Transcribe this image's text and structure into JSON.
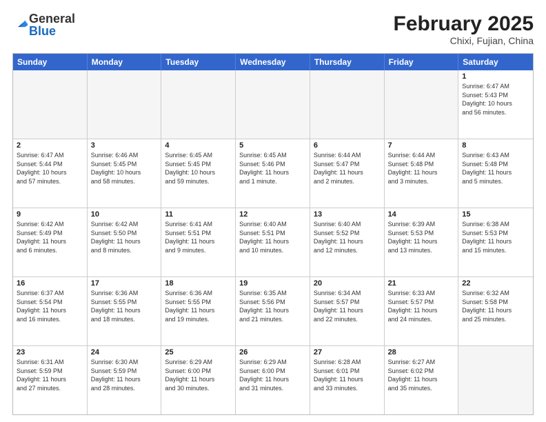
{
  "header": {
    "logo_general": "General",
    "logo_blue": "Blue",
    "month_title": "February 2025",
    "location": "Chixi, Fujian, China"
  },
  "calendar": {
    "days": [
      "Sunday",
      "Monday",
      "Tuesday",
      "Wednesday",
      "Thursday",
      "Friday",
      "Saturday"
    ],
    "rows": [
      [
        {
          "day": "",
          "empty": true
        },
        {
          "day": "",
          "empty": true
        },
        {
          "day": "",
          "empty": true
        },
        {
          "day": "",
          "empty": true
        },
        {
          "day": "",
          "empty": true
        },
        {
          "day": "",
          "empty": true
        },
        {
          "day": "1",
          "info": "Sunrise: 6:47 AM\nSunset: 5:43 PM\nDaylight: 10 hours\nand 56 minutes."
        }
      ],
      [
        {
          "day": "2",
          "info": "Sunrise: 6:47 AM\nSunset: 5:44 PM\nDaylight: 10 hours\nand 57 minutes."
        },
        {
          "day": "3",
          "info": "Sunrise: 6:46 AM\nSunset: 5:45 PM\nDaylight: 10 hours\nand 58 minutes."
        },
        {
          "day": "4",
          "info": "Sunrise: 6:45 AM\nSunset: 5:45 PM\nDaylight: 10 hours\nand 59 minutes."
        },
        {
          "day": "5",
          "info": "Sunrise: 6:45 AM\nSunset: 5:46 PM\nDaylight: 11 hours\nand 1 minute."
        },
        {
          "day": "6",
          "info": "Sunrise: 6:44 AM\nSunset: 5:47 PM\nDaylight: 11 hours\nand 2 minutes."
        },
        {
          "day": "7",
          "info": "Sunrise: 6:44 AM\nSunset: 5:48 PM\nDaylight: 11 hours\nand 3 minutes."
        },
        {
          "day": "8",
          "info": "Sunrise: 6:43 AM\nSunset: 5:48 PM\nDaylight: 11 hours\nand 5 minutes."
        }
      ],
      [
        {
          "day": "9",
          "info": "Sunrise: 6:42 AM\nSunset: 5:49 PM\nDaylight: 11 hours\nand 6 minutes."
        },
        {
          "day": "10",
          "info": "Sunrise: 6:42 AM\nSunset: 5:50 PM\nDaylight: 11 hours\nand 8 minutes."
        },
        {
          "day": "11",
          "info": "Sunrise: 6:41 AM\nSunset: 5:51 PM\nDaylight: 11 hours\nand 9 minutes."
        },
        {
          "day": "12",
          "info": "Sunrise: 6:40 AM\nSunset: 5:51 PM\nDaylight: 11 hours\nand 10 minutes."
        },
        {
          "day": "13",
          "info": "Sunrise: 6:40 AM\nSunset: 5:52 PM\nDaylight: 11 hours\nand 12 minutes."
        },
        {
          "day": "14",
          "info": "Sunrise: 6:39 AM\nSunset: 5:53 PM\nDaylight: 11 hours\nand 13 minutes."
        },
        {
          "day": "15",
          "info": "Sunrise: 6:38 AM\nSunset: 5:53 PM\nDaylight: 11 hours\nand 15 minutes."
        }
      ],
      [
        {
          "day": "16",
          "info": "Sunrise: 6:37 AM\nSunset: 5:54 PM\nDaylight: 11 hours\nand 16 minutes."
        },
        {
          "day": "17",
          "info": "Sunrise: 6:36 AM\nSunset: 5:55 PM\nDaylight: 11 hours\nand 18 minutes."
        },
        {
          "day": "18",
          "info": "Sunrise: 6:36 AM\nSunset: 5:55 PM\nDaylight: 11 hours\nand 19 minutes."
        },
        {
          "day": "19",
          "info": "Sunrise: 6:35 AM\nSunset: 5:56 PM\nDaylight: 11 hours\nand 21 minutes."
        },
        {
          "day": "20",
          "info": "Sunrise: 6:34 AM\nSunset: 5:57 PM\nDaylight: 11 hours\nand 22 minutes."
        },
        {
          "day": "21",
          "info": "Sunrise: 6:33 AM\nSunset: 5:57 PM\nDaylight: 11 hours\nand 24 minutes."
        },
        {
          "day": "22",
          "info": "Sunrise: 6:32 AM\nSunset: 5:58 PM\nDaylight: 11 hours\nand 25 minutes."
        }
      ],
      [
        {
          "day": "23",
          "info": "Sunrise: 6:31 AM\nSunset: 5:59 PM\nDaylight: 11 hours\nand 27 minutes."
        },
        {
          "day": "24",
          "info": "Sunrise: 6:30 AM\nSunset: 5:59 PM\nDaylight: 11 hours\nand 28 minutes."
        },
        {
          "day": "25",
          "info": "Sunrise: 6:29 AM\nSunset: 6:00 PM\nDaylight: 11 hours\nand 30 minutes."
        },
        {
          "day": "26",
          "info": "Sunrise: 6:29 AM\nSunset: 6:00 PM\nDaylight: 11 hours\nand 31 minutes."
        },
        {
          "day": "27",
          "info": "Sunrise: 6:28 AM\nSunset: 6:01 PM\nDaylight: 11 hours\nand 33 minutes."
        },
        {
          "day": "28",
          "info": "Sunrise: 6:27 AM\nSunset: 6:02 PM\nDaylight: 11 hours\nand 35 minutes."
        },
        {
          "day": "",
          "empty": true
        }
      ]
    ]
  }
}
